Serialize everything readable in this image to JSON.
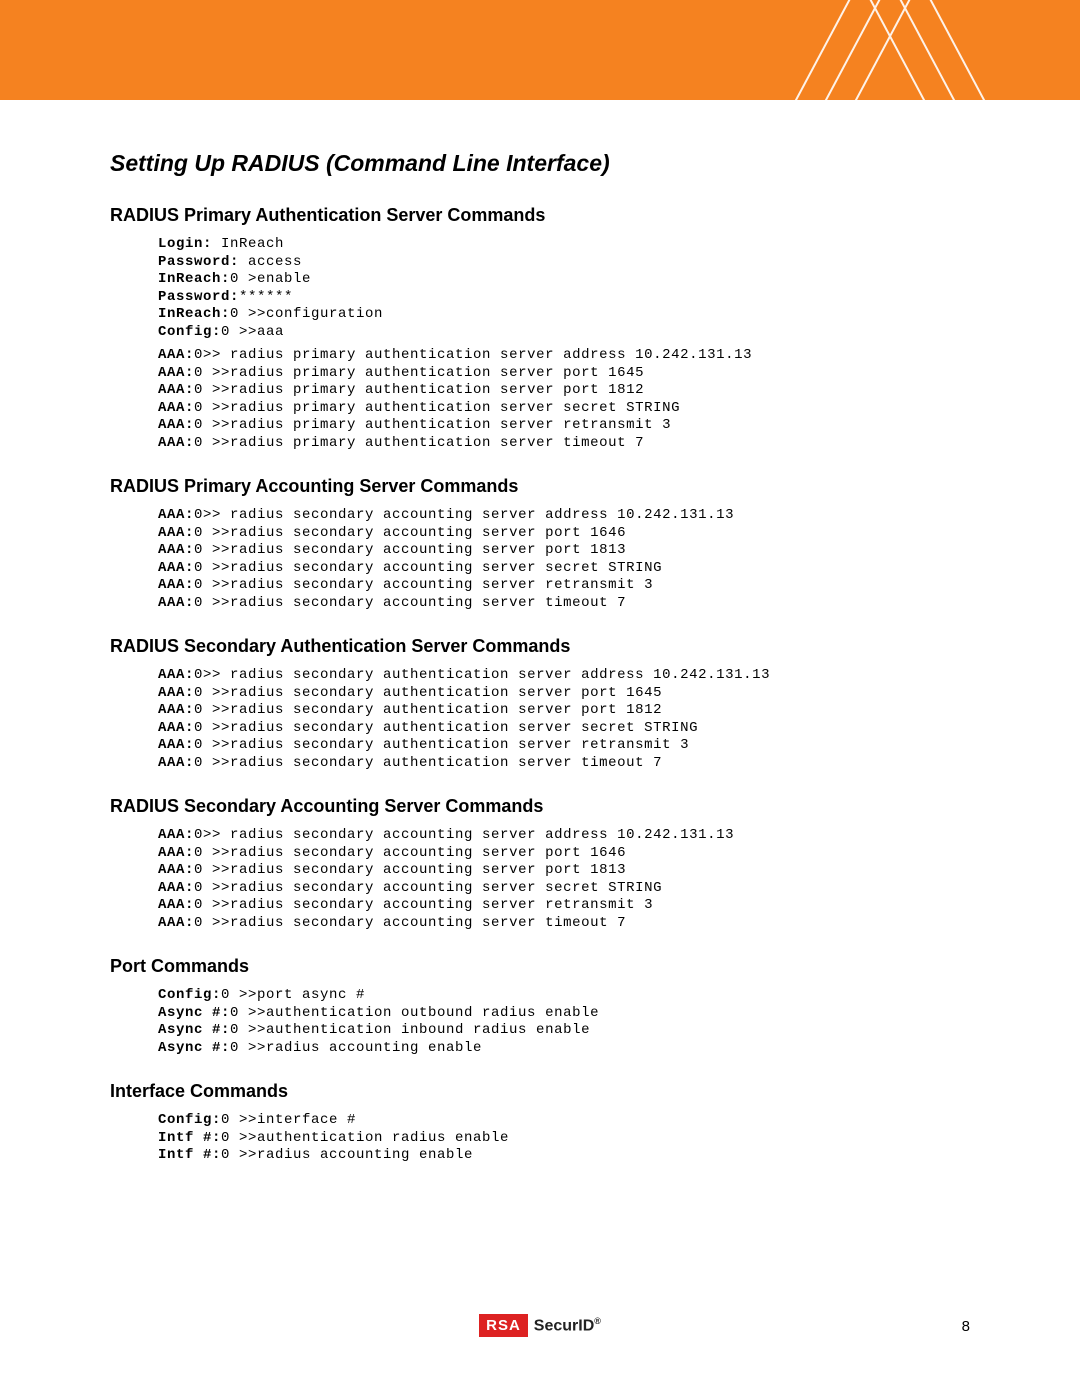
{
  "header": {
    "accent": "#f58220"
  },
  "title": "Setting Up RADIUS (Command Line Interface)",
  "sections": {
    "primary_auth": {
      "heading": "RADIUS Primary Authentication Server Commands",
      "login_lines": [
        {
          "bold": "Login:",
          "rest": " InReach"
        },
        {
          "bold": "Password:",
          "rest": " access"
        },
        {
          "bold": "InReach:",
          "rest": "0 >enable"
        },
        {
          "bold": "Password:",
          "rest": "******"
        },
        {
          "bold": "InReach:",
          "rest": "0 >>configuration"
        },
        {
          "bold": "Config:",
          "rest": "0 >>aaa"
        }
      ],
      "cmds": [
        {
          "bold": "AAA:",
          "rest": "0>> radius primary authentication server address 10.242.131.13"
        },
        {
          "bold": "AAA:",
          "rest": "0 >>radius primary authentication server port 1645"
        },
        {
          "bold": "AAA:",
          "rest": "0 >>radius primary authentication server port 1812"
        },
        {
          "bold": "AAA:",
          "rest": "0 >>radius primary authentication server secret STRING"
        },
        {
          "bold": "AAA:",
          "rest": "0 >>radius primary authentication server retransmit 3"
        },
        {
          "bold": "AAA:",
          "rest": "0 >>radius primary authentication server timeout 7"
        }
      ]
    },
    "primary_acct": {
      "heading": "RADIUS Primary Accounting Server Commands",
      "cmds": [
        {
          "bold": "AAA:",
          "rest": "0>> radius secondary accounting server address 10.242.131.13"
        },
        {
          "bold": "AAA:",
          "rest": "0 >>radius secondary accounting server port 1646"
        },
        {
          "bold": "AAA:",
          "rest": "0 >>radius secondary accounting server port 1813"
        },
        {
          "bold": "AAA:",
          "rest": "0 >>radius secondary accounting server secret STRING"
        },
        {
          "bold": "AAA:",
          "rest": "0 >>radius secondary accounting server retransmit 3"
        },
        {
          "bold": "AAA:",
          "rest": "0 >>radius secondary accounting server timeout 7"
        }
      ]
    },
    "secondary_auth": {
      "heading": "RADIUS Secondary Authentication Server Commands",
      "cmds": [
        {
          "bold": "AAA:",
          "rest": "0>> radius secondary authentication server address 10.242.131.13"
        },
        {
          "bold": "AAA:",
          "rest": "0 >>radius secondary authentication server port 1645"
        },
        {
          "bold": "AAA:",
          "rest": "0 >>radius secondary authentication server port 1812"
        },
        {
          "bold": "AAA:",
          "rest": "0 >>radius secondary authentication server secret STRING"
        },
        {
          "bold": "AAA:",
          "rest": "0 >>radius secondary authentication server retransmit 3"
        },
        {
          "bold": "AAA:",
          "rest": "0 >>radius secondary authentication server timeout 7"
        }
      ]
    },
    "secondary_acct": {
      "heading": "RADIUS Secondary Accounting Server Commands",
      "cmds": [
        {
          "bold": "AAA:",
          "rest": "0>> radius secondary accounting server address 10.242.131.13"
        },
        {
          "bold": "AAA:",
          "rest": "0 >>radius secondary accounting server port 1646"
        },
        {
          "bold": "AAA:",
          "rest": "0 >>radius secondary accounting server port 1813"
        },
        {
          "bold": "AAA:",
          "rest": "0 >>radius secondary accounting server secret STRING"
        },
        {
          "bold": "AAA:",
          "rest": "0 >>radius secondary accounting server retransmit 3"
        },
        {
          "bold": "AAA:",
          "rest": "0 >>radius secondary accounting server timeout 7"
        }
      ]
    },
    "port": {
      "heading": "Port Commands",
      "cmds": [
        {
          "bold": "Config:",
          "rest": "0 >>port async #"
        },
        {
          "bold": "Async #:",
          "rest": "0 >>authentication outbound radius enable"
        },
        {
          "bold": "Async #:",
          "rest": "0 >>authentication inbound radius enable"
        },
        {
          "bold": "Async #:",
          "rest": "0 >>radius accounting enable"
        }
      ]
    },
    "interface": {
      "heading": "Interface Commands",
      "cmds": [
        {
          "bold": "Config:",
          "rest": "0 >>interface #"
        },
        {
          "bold": "Intf #:",
          "rest": "0 >>authentication radius enable"
        },
        {
          "bold": "Intf #:",
          "rest": "0 >>radius accounting enable"
        }
      ]
    }
  },
  "footer": {
    "logo_left": "RSA",
    "logo_right": "SecurID",
    "page": "8"
  }
}
